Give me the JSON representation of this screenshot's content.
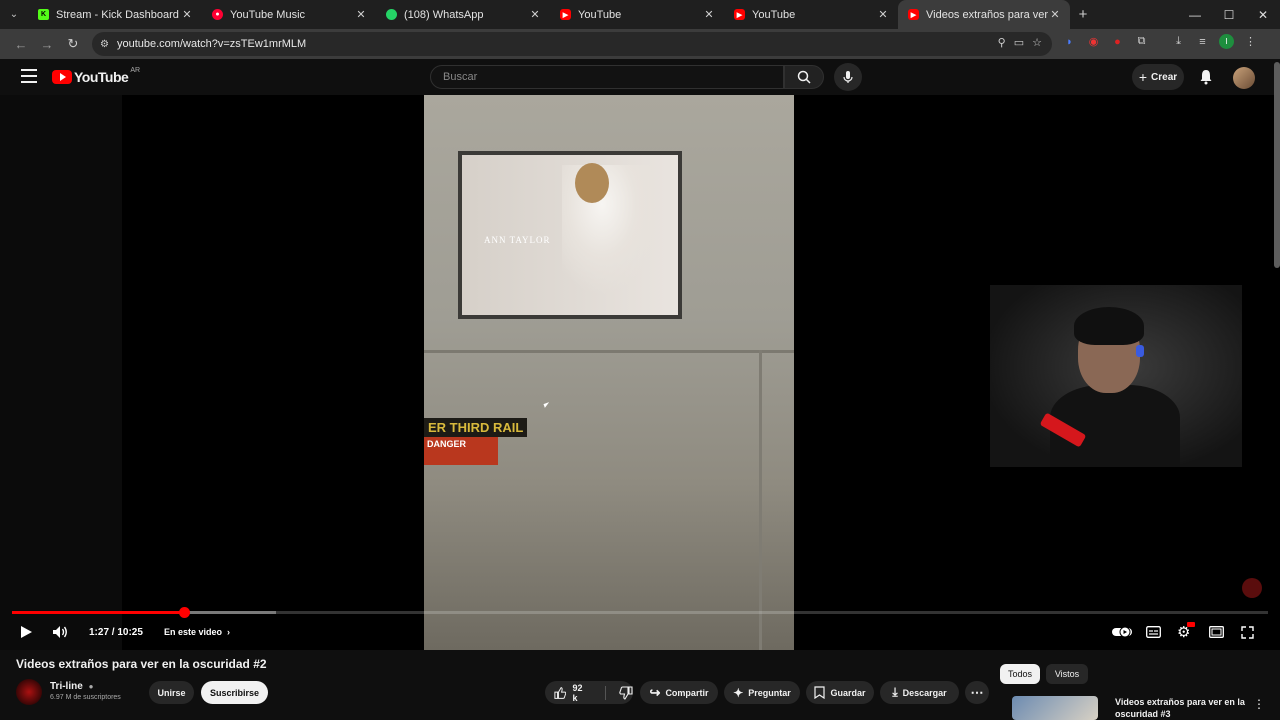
{
  "browser": {
    "tabs": [
      {
        "title": "Stream - Kick Dashboard",
        "icon": "kick-icon",
        "color": "#53fc18"
      },
      {
        "title": "YouTube Music",
        "icon": "youtube-music-icon",
        "color": "#ff0033"
      },
      {
        "title": "(108) WhatsApp",
        "icon": "whatsapp-icon",
        "color": "#25d366"
      },
      {
        "title": "YouTube",
        "icon": "youtube-icon",
        "color": "#ff0000"
      },
      {
        "title": "YouTube",
        "icon": "youtube-icon",
        "color": "#ff0000"
      },
      {
        "title": "Videos extraños para ver en la o",
        "icon": "youtube-icon",
        "color": "#ff0000"
      }
    ],
    "url": "youtube.com/watch?v=zsTEw1mrMLM"
  },
  "youtube": {
    "logo": "YouTube",
    "country_code": "AR",
    "search_placeholder": "Buscar",
    "create_label": "Crear"
  },
  "video_frame": {
    "poster_brand": "ANN TAYLOR",
    "sign_text": "ER THIRD RAIL",
    "danger_text": "DANGER"
  },
  "player": {
    "time": "1:27 / 10:25",
    "chapter": "En este video",
    "progress": 0.137,
    "buffered": 0.21
  },
  "video": {
    "title": "Videos extraños para ver en la oscuridad #2",
    "channel": "Tri-line",
    "subscribers": "6.97 M de suscriptores",
    "join_label": "Unirse",
    "subscribe_label": "Suscribirse",
    "likes": "92 k",
    "share_label": "Compartir",
    "ask_label": "Preguntar",
    "save_label": "Guardar",
    "download_label": "Descargar"
  },
  "sidebar": {
    "chips": [
      "Todos",
      "Vistos"
    ],
    "recommended_title": "Videos extraños para ver en la oscuridad #3"
  },
  "colors": {
    "accent": "#ff0000",
    "background": "#0f0f0f"
  }
}
